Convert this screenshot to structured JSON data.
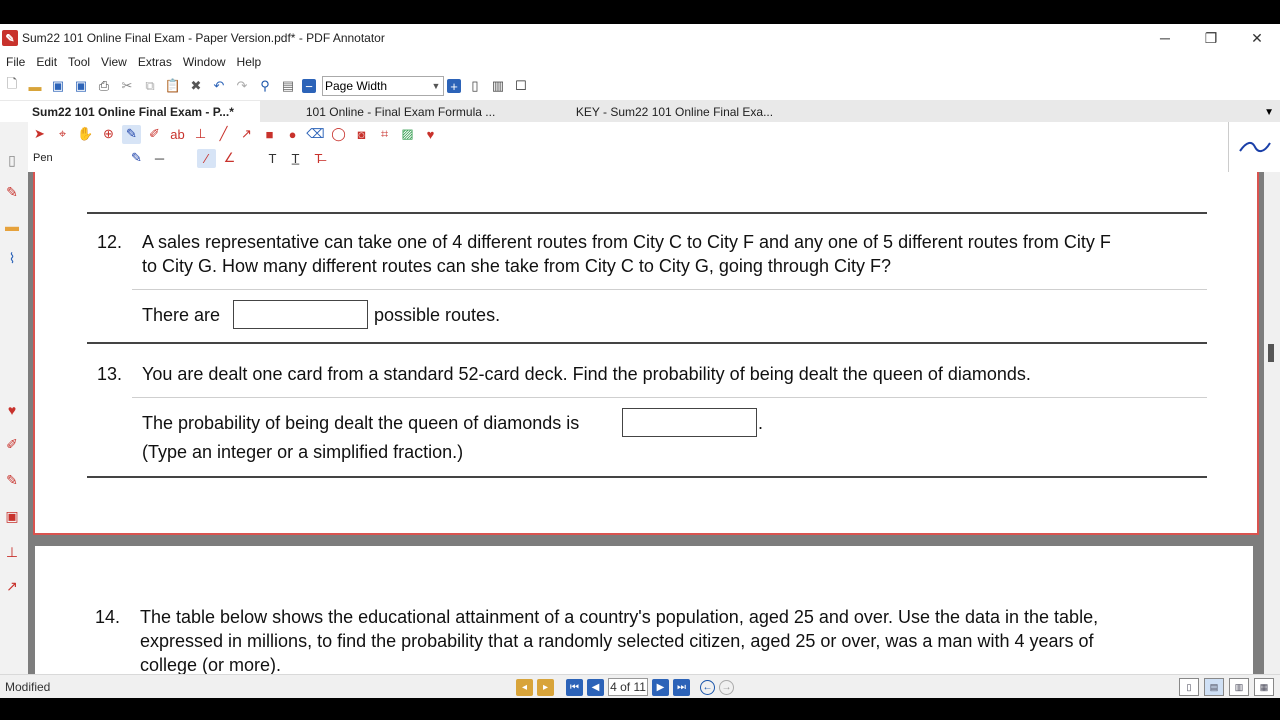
{
  "window": {
    "title": "Sum22 101 Online Final Exam - Paper Version.pdf* - PDF Annotator"
  },
  "menu": [
    "File",
    "Edit",
    "Tool",
    "View",
    "Extras",
    "Window",
    "Help"
  ],
  "toolbar": {
    "zoom_value": "Page Width"
  },
  "tabs": [
    {
      "label": "Sum22 101 Online Final Exam - P...*",
      "active": true
    },
    {
      "label": "101 Online - Final Exam Formula ...",
      "active": false
    },
    {
      "label": "KEY - Sum22 101 Online Final Exa...",
      "active": false
    }
  ],
  "annotation_toolbar": {
    "tool_label": "Pen"
  },
  "document": {
    "q12": {
      "number": "12.",
      "line1": "A sales representative can take one of 4 different routes from City C to City F and any one of 5 different routes from City F",
      "line2": "to City G. How many different routes can she take from City C to City G, going through City F?",
      "answer_prefix": "There are",
      "answer_suffix": "possible routes."
    },
    "q13": {
      "number": "13.",
      "text": "You are dealt one card from a standard 52-card deck.  Find the probability of being dealt the queen of diamonds.",
      "answer_prefix": "The probability of being dealt the queen of diamonds is",
      "answer_suffix": ".",
      "hint": "(Type an integer or a simplified fraction.)"
    },
    "q14": {
      "number": "14.",
      "line1": "The table below shows the educational attainment of a country's population, aged 25 and over.  Use the data in the table,",
      "line2": "expressed in millions, to find the probability that a randomly selected citizen, aged 25 or over, was a man with 4 years of",
      "line3": "college (or more)."
    }
  },
  "status": {
    "state": "Modified",
    "page_indicator": "4 of 11"
  },
  "colors": {
    "accent": "#2c63b8",
    "page_border": "#d9534f",
    "pen": "#1a3fa8"
  }
}
